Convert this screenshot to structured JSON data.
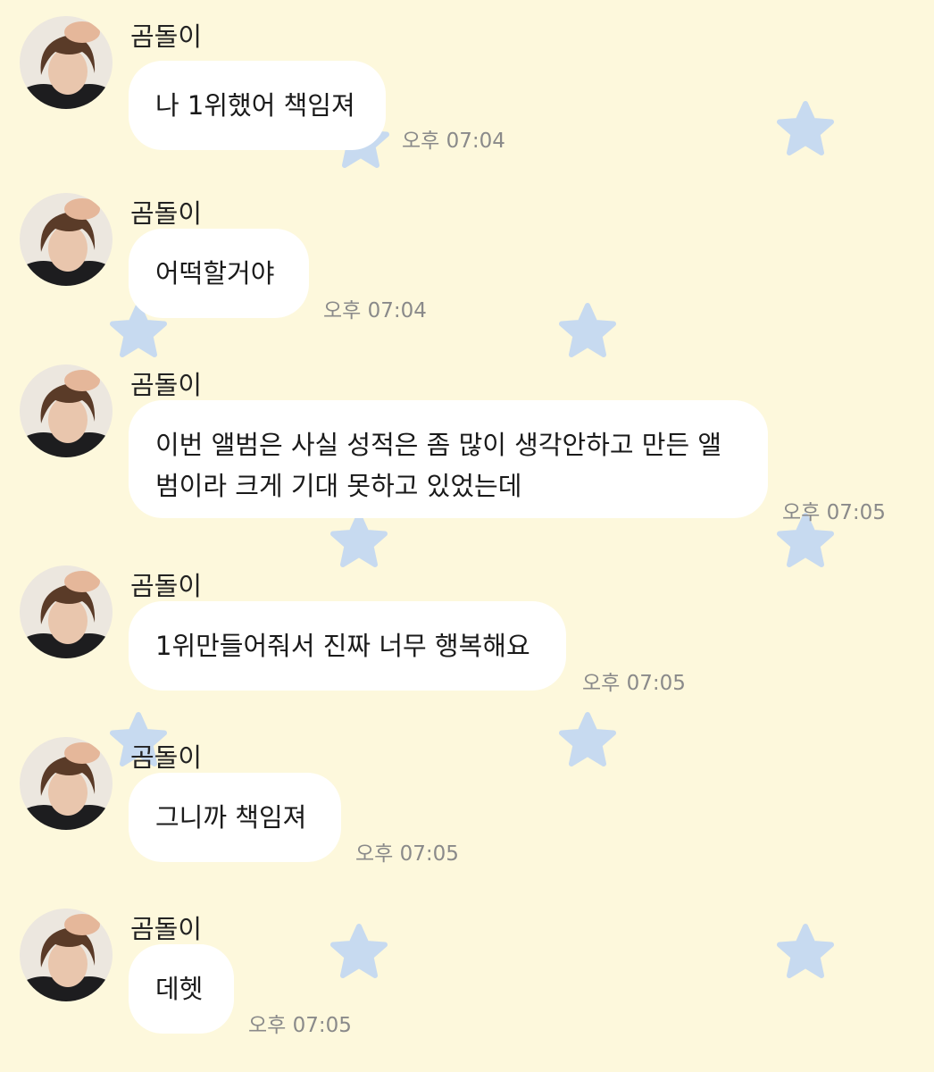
{
  "theme": {
    "background": "#fdf8dc",
    "star_color": "#c7daf0",
    "bubble_color": "#ffffff",
    "time_color": "#8a8a8a"
  },
  "messages": [
    {
      "sender": "곰돌이",
      "lines": [
        "나 1위했어 책임져"
      ],
      "time": "오후 07:04"
    },
    {
      "sender": "곰돌이",
      "lines": [
        "어떡할거야"
      ],
      "time": "오후 07:04"
    },
    {
      "sender": "곰돌이",
      "lines": [
        "이번 앨범은 사실 성적은 좀 많이 생각안하고 만든 앨",
        "범이라 크게 기대 못하고 있었는데"
      ],
      "time": "오후 07:05"
    },
    {
      "sender": "곰돌이",
      "lines": [
        "1위만들어줘서 진짜 너무 행복해요"
      ],
      "time": "오후 07:05"
    },
    {
      "sender": "곰돌이",
      "lines": [
        "그니까 책임져"
      ],
      "time": "오후 07:05"
    },
    {
      "sender": "곰돌이",
      "lines": [
        "데헷"
      ],
      "time": "오후 07:05"
    }
  ]
}
